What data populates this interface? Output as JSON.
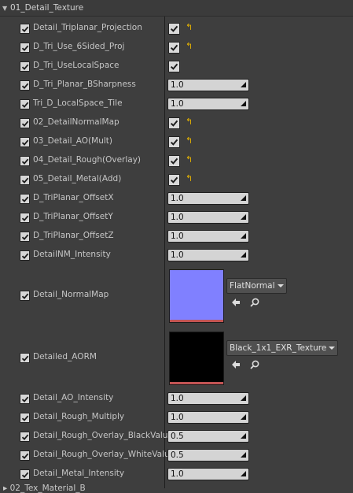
{
  "category": {
    "title": "01_Detail_Texture"
  },
  "rows": [
    {
      "name": "Detail_Triplanar_Projection",
      "kind": "bool",
      "reset": true
    },
    {
      "name": "D_Tri_Use_6Sided_Proj",
      "kind": "bool",
      "reset": true
    },
    {
      "name": "D_Tri_UseLocalSpace",
      "kind": "bool",
      "reset": false
    },
    {
      "name": "D_Tri_Planar_BSharpness",
      "kind": "number",
      "value": "1.0"
    },
    {
      "name": "Tri_D_LocalSpace_Tile",
      "kind": "number",
      "value": "1.0"
    },
    {
      "name": "02_DetailNormalMap",
      "kind": "bool",
      "reset": true
    },
    {
      "name": "03_Detail_AO(Mult)",
      "kind": "bool",
      "reset": true
    },
    {
      "name": "04_Detail_Rough(Overlay)",
      "kind": "bool",
      "reset": true
    },
    {
      "name": "05_Detail_Metal(Add)",
      "kind": "bool",
      "reset": true
    },
    {
      "name": "D_TriPlanar_OffsetX",
      "kind": "number",
      "value": "1.0"
    },
    {
      "name": "D_TriPlanar_OffsetY",
      "kind": "number",
      "value": "1.0"
    },
    {
      "name": "D_TriPlanar_OffsetZ",
      "kind": "number",
      "value": "1.0"
    },
    {
      "name": "DetailNM_Intensity",
      "kind": "number",
      "value": "1.0"
    },
    {
      "name": "Detail_NormalMap",
      "kind": "texture",
      "texture": "FlatNormal",
      "color": "#8080ff"
    },
    {
      "name": "Detailed_AORM",
      "kind": "texture",
      "texture": "Black_1x1_EXR_Texture",
      "color": "#000000"
    },
    {
      "name": "Detail_AO_Intensity",
      "kind": "number",
      "value": "1.0"
    },
    {
      "name": "Detail_Rough_Multiply",
      "kind": "number",
      "value": "1.0"
    },
    {
      "name": "Detail_Rough_Overlay_BlackValue",
      "kind": "number",
      "value": "0.5"
    },
    {
      "name": "Detail_Rough_Overlay_WhiteValue",
      "kind": "number",
      "value": "0.5"
    },
    {
      "name": "Detail_Metal_Intensity",
      "kind": "number",
      "value": "1.0"
    }
  ],
  "footer": {
    "label": "▸ 02_Tex_Material_B"
  },
  "colors": {
    "panel": "#3e3e3e",
    "reset_arrow": "#e8b400",
    "texture_bar": "#c25454"
  }
}
